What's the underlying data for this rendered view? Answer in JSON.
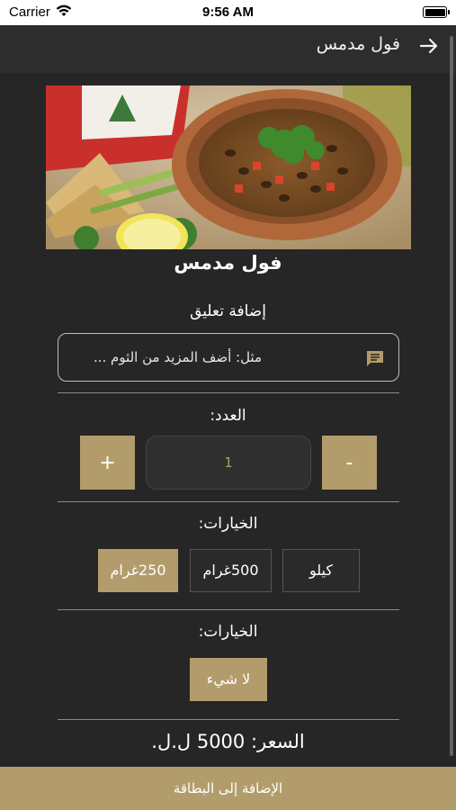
{
  "status_bar": {
    "carrier": "Carrier",
    "time": "9:56 AM"
  },
  "nav": {
    "title": "فول مدمس",
    "back_icon": "arrow-right-icon"
  },
  "dish": {
    "title": "فول مدمس"
  },
  "comment": {
    "label": "إضافة تعليق",
    "placeholder": "مثل: أضف المزيد من الثوم ...",
    "icon": "comment-icon"
  },
  "quantity": {
    "label": "العدد:",
    "value": "1",
    "plus_label": "+",
    "minus_label": "-"
  },
  "options_size": {
    "label": "الخيارات:",
    "items": [
      "كيلو",
      "500غرام",
      "250غرام"
    ],
    "selected": "250غرام"
  },
  "options_extra": {
    "label": "الخيارات:",
    "items": [
      "لا شيء"
    ],
    "selected": "لا شيء"
  },
  "price": {
    "text": "السعر: 5000 ل.ل."
  },
  "cart": {
    "button_label": "الإضافة إلى البطاقة"
  },
  "colors": {
    "background": "#262626",
    "accent_gold": "#b39c6b",
    "navbar": "#2d2d2d"
  }
}
